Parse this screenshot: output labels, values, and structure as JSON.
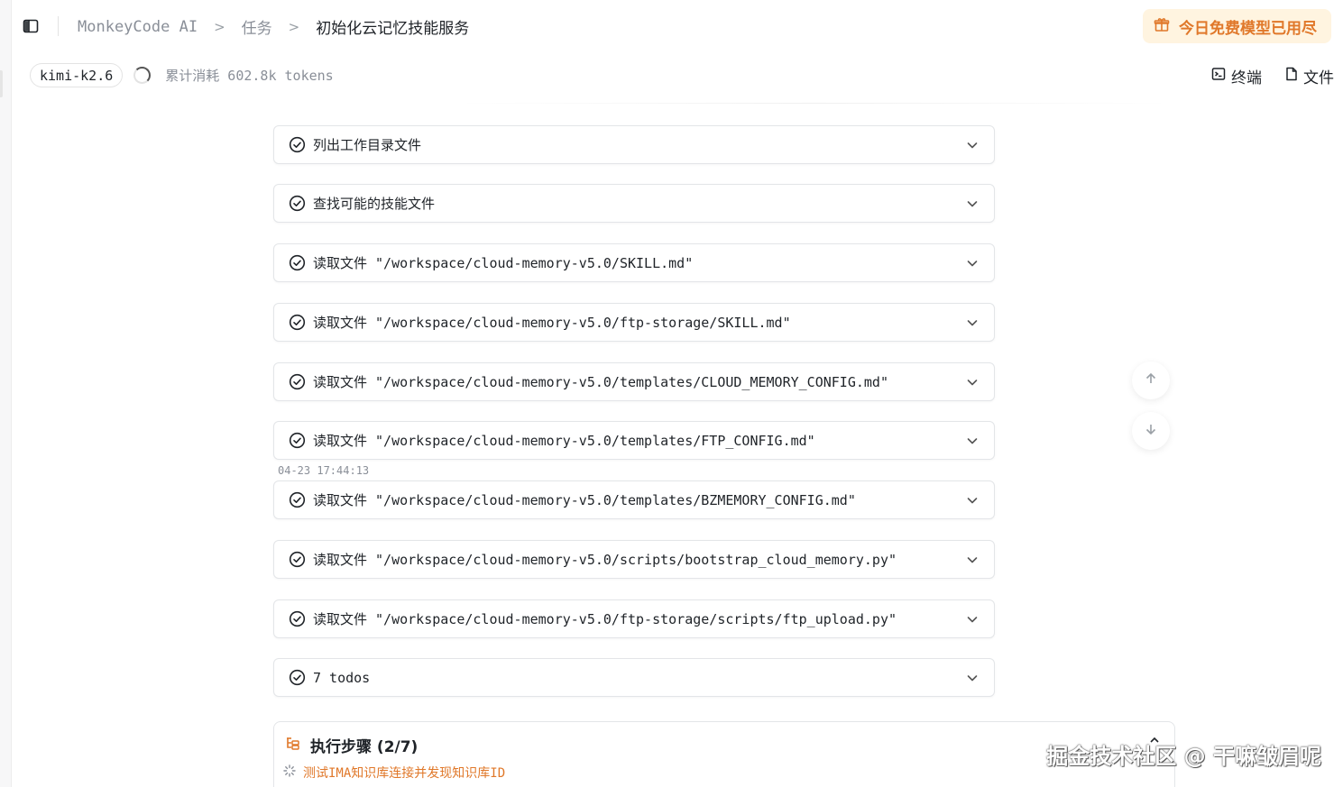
{
  "header": {
    "breadcrumbs": [
      "MonkeyCode AI",
      "任务",
      "初始化云记忆技能服务"
    ],
    "quota_text": "今日免费模型已用尽"
  },
  "meta": {
    "model": "kimi-k2.6",
    "usage": "累计消耗 602.8k tokens"
  },
  "toolbar": {
    "terminal_label": "终端",
    "files_label": "文件"
  },
  "steps": [
    {
      "label": "列出工作目录文件"
    },
    {
      "label": "查找可能的技能文件"
    },
    {
      "label": "读取文件 \"/workspace/cloud-memory-v5.0/SKILL.md\""
    },
    {
      "label": "读取文件 \"/workspace/cloud-memory-v5.0/ftp-storage/SKILL.md\""
    },
    {
      "label": "读取文件 \"/workspace/cloud-memory-v5.0/templates/CLOUD_MEMORY_CONFIG.md\""
    },
    {
      "label": "读取文件 \"/workspace/cloud-memory-v5.0/templates/FTP_CONFIG.md\""
    },
    {
      "label": "读取文件 \"/workspace/cloud-memory-v5.0/templates/BZMEMORY_CONFIG.md\""
    },
    {
      "label": "读取文件 \"/workspace/cloud-memory-v5.0/scripts/bootstrap_cloud_memory.py\""
    },
    {
      "label": "读取文件 \"/workspace/cloud-memory-v5.0/ftp-storage/scripts/ftp_upload.py\""
    },
    {
      "label": "7 todos"
    }
  ],
  "timestamp": "04-23 17:44:13",
  "plan": {
    "title": "执行步骤 (2/7)",
    "current_step": "测试IMA知识库连接并发现知识库ID"
  },
  "watermark": "掘金技术社区 @ 干嘛皱眉呢",
  "colors": {
    "accent": "#e0782a",
    "quota_bg": "#fff4e0",
    "border": "#e3e5e8",
    "muted_text": "#8a8f98"
  }
}
